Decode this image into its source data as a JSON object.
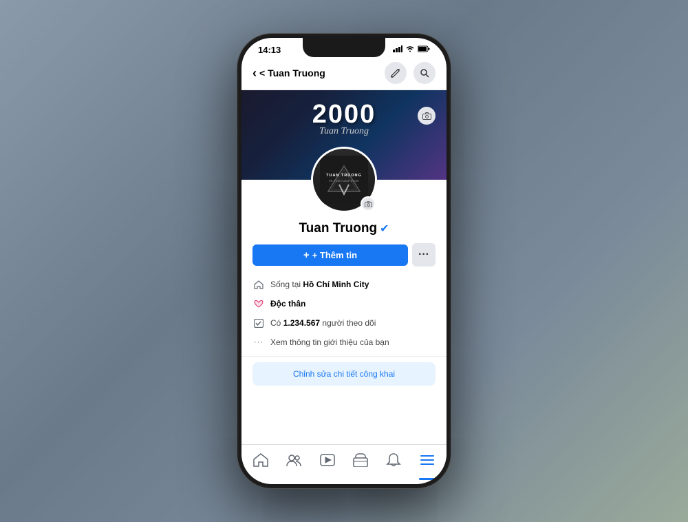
{
  "background": {
    "color": "#7a8a9a"
  },
  "status_bar": {
    "time": "14:13",
    "signal": "▌▌▌",
    "wifi": "WiFi",
    "battery": "🔋"
  },
  "nav_header": {
    "back_label": "< Tuan Truong",
    "edit_icon": "✏",
    "search_icon": "🔍"
  },
  "cover": {
    "text_2000": "2000",
    "signature": "Tuan Truong"
  },
  "avatar": {
    "logo_text": "TUAN TRUONG",
    "logo_sub": "FB.COM/TUANTRUOE"
  },
  "profile": {
    "name": "Tuan Truong",
    "verified": true,
    "add_info_label": "+ Thêm tin",
    "more_label": "···"
  },
  "info_items": [
    {
      "icon": "🏠",
      "text_before": "Sống tại ",
      "text_bold": "Hồ Chí Minh City",
      "text_after": ""
    },
    {
      "icon": "❤",
      "text_before": "",
      "text_bold": "Độc thân",
      "text_after": ""
    },
    {
      "icon": "✓",
      "text_before": "Có ",
      "text_bold": "1.234.567",
      "text_after": " người theo dõi"
    },
    {
      "icon": "···",
      "text_before": "Xem thông tin giới thiệu của bạn",
      "text_bold": "",
      "text_after": ""
    }
  ],
  "edit_public": {
    "label": "Chỉnh sửa chi tiết công khai"
  },
  "bottom_nav": {
    "tabs": [
      {
        "icon": "🏠",
        "label": "home",
        "active": false
      },
      {
        "icon": "👥",
        "label": "friends",
        "active": false
      },
      {
        "icon": "▶",
        "label": "watch",
        "active": false
      },
      {
        "icon": "🏪",
        "label": "marketplace",
        "active": false
      },
      {
        "icon": "🔔",
        "label": "notifications",
        "active": false
      },
      {
        "icon": "≡",
        "label": "menu",
        "active": true
      }
    ]
  }
}
